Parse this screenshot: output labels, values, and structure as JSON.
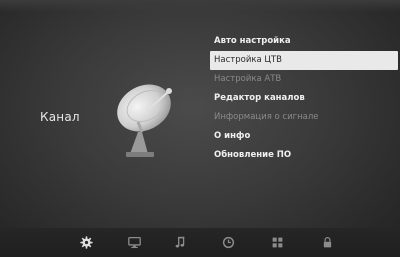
{
  "section": {
    "title": "Канал"
  },
  "menu": {
    "items": [
      {
        "label": "Авто настройка",
        "state": "normal"
      },
      {
        "label": "Настройка ЦТВ",
        "state": "selected"
      },
      {
        "label": "Настройка АТВ",
        "state": "disabled"
      },
      {
        "label": "Редактор каналов",
        "state": "normal"
      },
      {
        "label": "Информация о сигнале",
        "state": "disabled"
      },
      {
        "label": "О инфо",
        "state": "normal"
      },
      {
        "label": "Обновление ПО",
        "state": "normal"
      }
    ]
  },
  "bottom_tabs": [
    {
      "icon": "gear-icon",
      "active": true
    },
    {
      "icon": "monitor-icon",
      "active": false
    },
    {
      "icon": "music-note-icon",
      "active": false
    },
    {
      "icon": "clock-icon",
      "active": false
    },
    {
      "icon": "grid-icon",
      "active": false
    },
    {
      "icon": "lock-icon",
      "active": false
    }
  ],
  "colors": {
    "background": "#3a3a3a",
    "menu_text": "#f0f0f0",
    "menu_disabled": "#8a8a8a",
    "selection_bg": "#e9e9e9",
    "selection_text": "#2a2a2a",
    "icon_active": "#e0e0e0",
    "icon_inactive": "#8c8c8c"
  }
}
